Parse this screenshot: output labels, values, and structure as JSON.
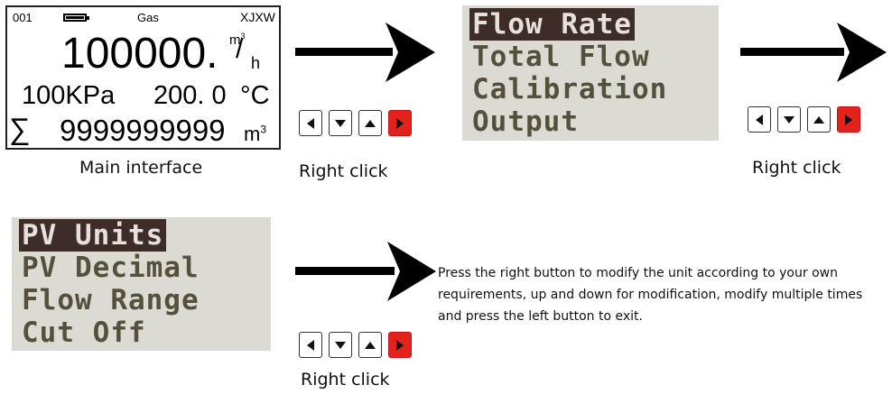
{
  "main_display": {
    "address": "001",
    "medium": "Gas",
    "brand": "XJXW",
    "flow_value": "100000.",
    "flow_unit_num": "m",
    "flow_unit_sup": "3",
    "flow_unit_den": "h",
    "pressure": "100KPa",
    "temperature": "200. 0",
    "temperature_unit": "°C",
    "sigma": "∑",
    "total": "9999999999",
    "total_unit": "m",
    "total_unit_sup": "3"
  },
  "captions": {
    "main": "Main interface",
    "right_click_1": "Right click",
    "right_click_2": "Right click",
    "right_click_3": "Right click"
  },
  "menu1": [
    "Flow Rate",
    "Total Flow",
    "Calibration",
    "Output"
  ],
  "menu2": [
    "PV Units",
    "PV Decimal",
    "Flow Range",
    "Cut Off"
  ],
  "note": "Press the right button to modify the unit according to your own requirements, up and down for modification, modify multiple times and press the left button to exit.",
  "colors": {
    "lcd_bg": "#dcdbd3",
    "selected_bg": "#3e2c28",
    "right_button": "#e3221c"
  }
}
